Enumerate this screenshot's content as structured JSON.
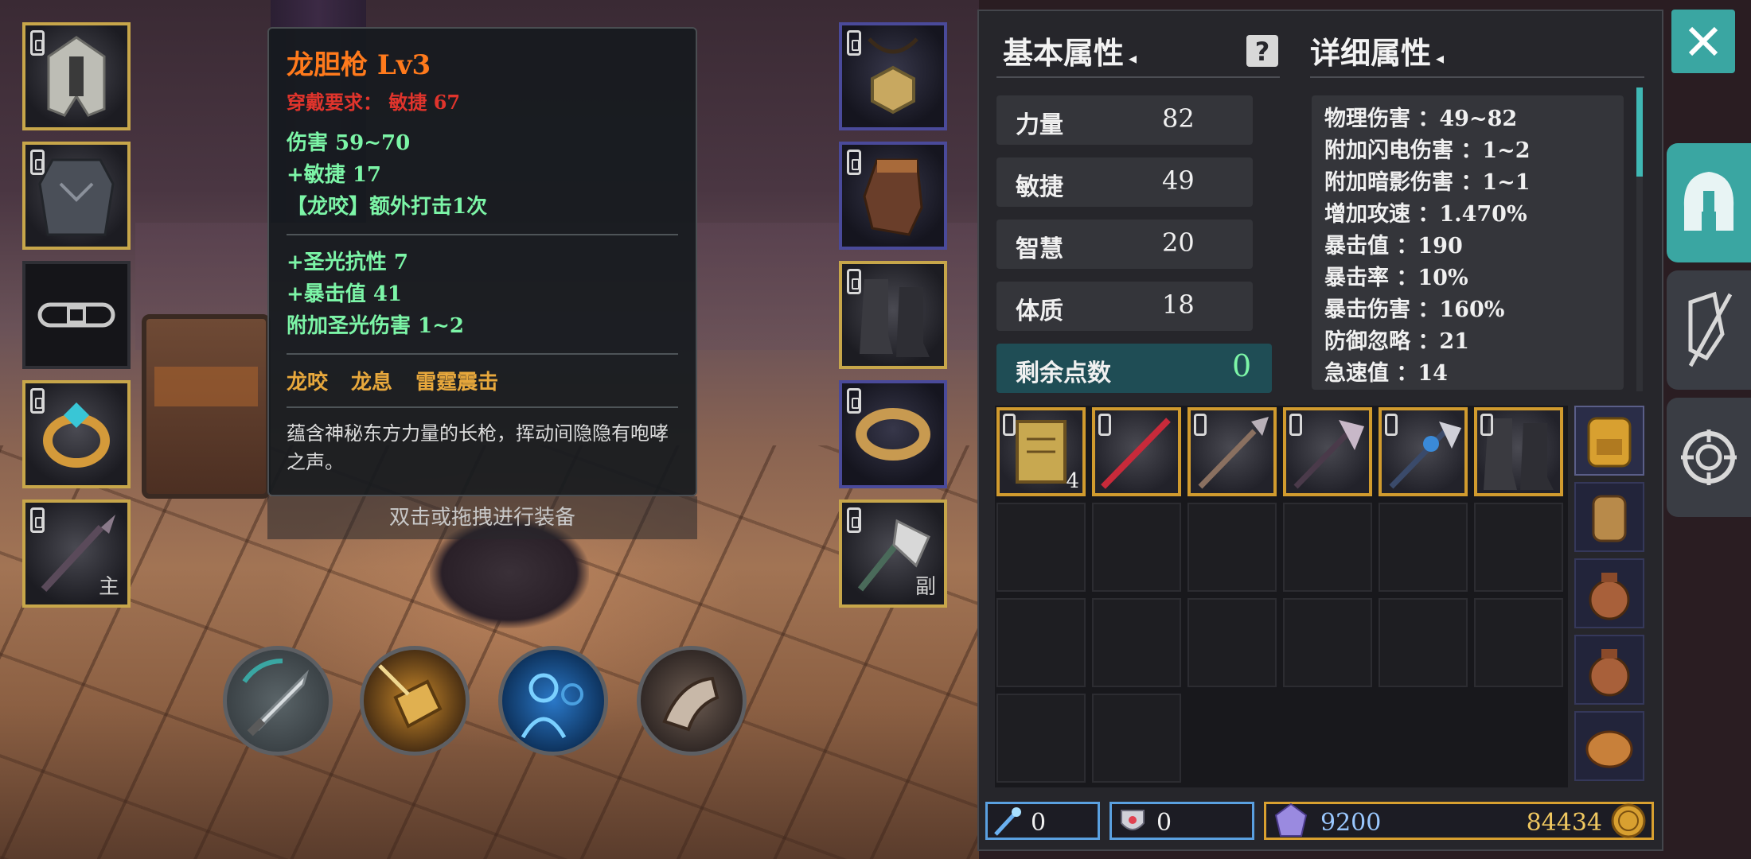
{
  "tooltip": {
    "title": "龙胆枪 Lv3",
    "requirement": "穿戴要求：  敏捷 67",
    "base_stats": [
      "伤害   59~70",
      "+敏捷  17",
      "【龙咬】额外打击1次"
    ],
    "extra_stats": [
      "+圣光抗性  7",
      "+暴击值  41",
      "附加圣光伤害  1~2"
    ],
    "skills": "龙咬 龙息 雷霆震击",
    "description": "蕴含神秘东方力量的长枪，挥动间隐隐有咆哮之声。",
    "hint": "双击或拖拽进行装备"
  },
  "equipment": {
    "left_slots": [
      {
        "name": "helmet",
        "tag": ""
      },
      {
        "name": "chest-armor",
        "tag": ""
      },
      {
        "name": "belt",
        "tag": ""
      },
      {
        "name": "ring",
        "tag": ""
      },
      {
        "name": "main-weapon",
        "tag": "主"
      }
    ],
    "right_slots": [
      {
        "name": "amulet",
        "tag": ""
      },
      {
        "name": "gloves",
        "tag": ""
      },
      {
        "name": "boots",
        "tag": ""
      },
      {
        "name": "bracelet",
        "tag": ""
      },
      {
        "name": "off-weapon",
        "tag": "副"
      }
    ]
  },
  "skills": [
    "sword-skill-icon",
    "hammer-skill-icon",
    "shadow-clone-skill-icon",
    "beast-skill-icon"
  ],
  "basic_attributes": {
    "header": "基本属性",
    "stats": [
      {
        "name": "力量",
        "value": "82"
      },
      {
        "name": "敏捷",
        "value": "49"
      },
      {
        "name": "智慧",
        "value": "20"
      },
      {
        "name": "体质",
        "value": "18"
      }
    ],
    "remaining_label": "剩余点数",
    "remaining_value": "0"
  },
  "detail_attributes": {
    "header": "详细属性",
    "lines": [
      "物理伤害 ：49~82",
      "附加闪电伤害 ：1~2",
      "附加暗影伤害 ：1~1",
      "增加攻速 ：1.470%",
      "暴击值 ：190",
      "暴击率 ：10%",
      "暴击伤害 ：160%",
      "防御忽略 ：21",
      "急速值 ：14"
    ]
  },
  "inventory": {
    "scroll_count": "4",
    "items": [
      "scroll",
      "red-spear",
      "spear",
      "halberd",
      "blue-glaive",
      "boots"
    ],
    "bags": [
      "backpack-yellow",
      "backpack-small",
      "pouch",
      "pouch",
      "pouch-open"
    ]
  },
  "currency": {
    "wand": "0",
    "shield": "0",
    "crystal": "9200",
    "gold": "84434"
  },
  "colors": {
    "accent": "#3aa6a2",
    "item_title": "#ff7a1c",
    "stat_green": "#7cf5a7",
    "requirement_red": "#e0342c",
    "skill_gold": "#e8a83c"
  }
}
